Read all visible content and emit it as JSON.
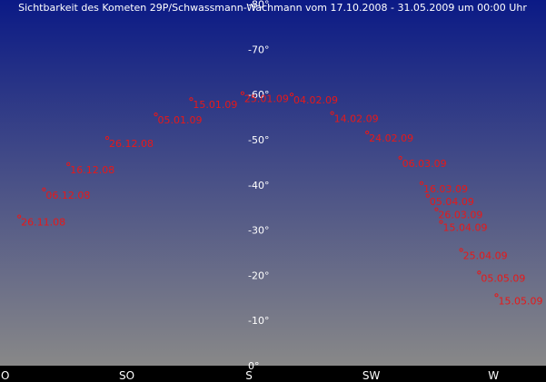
{
  "chart_data": {
    "type": "scatter",
    "title": "Sichtbarkeit des Kometen 29P/Schwassmann-Wachmann vom 17.10.2008 - 31.05.2009 um 00:00 Uhr",
    "xlabel": "",
    "ylabel": "",
    "y_axis_top_label": "-70°",
    "ylim": [
      0,
      80
    ],
    "xlim": [
      90,
      276
    ],
    "grid": false,
    "background_gradient": [
      "#0b1a86",
      "#888888"
    ],
    "mark_color": "#e81818",
    "y_ticks": [
      {
        "value": 0,
        "label": "0°"
      },
      {
        "value": 10,
        "label": "-10°"
      },
      {
        "value": 20,
        "label": "-20°"
      },
      {
        "value": 30,
        "label": "-30°"
      },
      {
        "value": 40,
        "label": "-40°"
      },
      {
        "value": 50,
        "label": "-50°"
      },
      {
        "value": 60,
        "label": "-60°"
      },
      {
        "value": 70,
        "label": "-70°"
      },
      {
        "value": 80,
        "label": "-80°"
      }
    ],
    "x_ticks": [
      {
        "value": 90,
        "label": "O"
      },
      {
        "value": 135,
        "label": "SO"
      },
      {
        "value": 180,
        "label": "S"
      },
      {
        "value": 225,
        "label": "SW"
      },
      {
        "value": 270,
        "label": "W"
      }
    ],
    "points": [
      {
        "label": "26.11.08",
        "azimuth": 95.4,
        "altitude": 33.0
      },
      {
        "label": "06.12.08",
        "azimuth": 104.5,
        "altitude": 39.0
      },
      {
        "label": "16.12.08",
        "azimuth": 113.5,
        "altitude": 44.6
      },
      {
        "label": "26.12.08",
        "azimuth": 127.8,
        "altitude": 50.4
      },
      {
        "label": "05.01.09",
        "azimuth": 145.7,
        "altitude": 55.6
      },
      {
        "label": "15.01.09",
        "azimuth": 158.7,
        "altitude": 59.0
      },
      {
        "label": "25.01.09",
        "azimuth": 177.6,
        "altitude": 60.3
      },
      {
        "label": "04.02.09",
        "azimuth": 195.7,
        "altitude": 60.0
      },
      {
        "label": "14.02.09",
        "azimuth": 210.6,
        "altitude": 55.9
      },
      {
        "label": "24.02.09",
        "azimuth": 223.5,
        "altitude": 51.6
      },
      {
        "label": "06.03.09",
        "azimuth": 235.7,
        "altitude": 46.0
      },
      {
        "label": "16.03.09",
        "azimuth": 243.5,
        "altitude": 40.4
      },
      {
        "label": "26.03.09",
        "azimuth": 249.0,
        "altitude": 34.6
      },
      {
        "label": "05.04.09",
        "azimuth": 245.8,
        "altitude": 37.6
      },
      {
        "label": "15.04.09",
        "azimuth": 250.7,
        "altitude": 31.8
      },
      {
        "label": "25.04.09",
        "azimuth": 258.1,
        "altitude": 25.6
      },
      {
        "label": "05.05.09",
        "azimuth": 264.7,
        "altitude": 20.6
      },
      {
        "label": "15.05.09",
        "azimuth": 271.1,
        "altitude": 15.6
      }
    ]
  }
}
